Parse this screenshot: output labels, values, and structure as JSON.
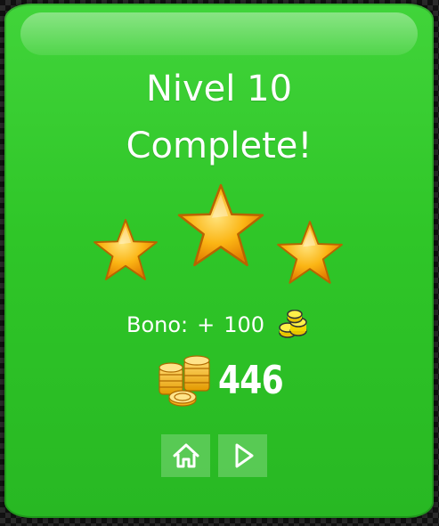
{
  "level_complete": {
    "title_line1": "Nivel 10",
    "title_line2": "Complete!",
    "stars_earned": 3,
    "stars_total": 3
  },
  "bonus": {
    "label": "Bono:",
    "sign": "+",
    "value": "100",
    "icon": "small-coins-icon"
  },
  "coins": {
    "total": "446",
    "icon": "coin-stack-icon"
  },
  "buttons": {
    "home_icon": "home-icon",
    "play_icon": "play-icon"
  },
  "colors": {
    "panel_green": "#2fc628",
    "star_gold": "#f9b000",
    "text": "#ffffff"
  }
}
